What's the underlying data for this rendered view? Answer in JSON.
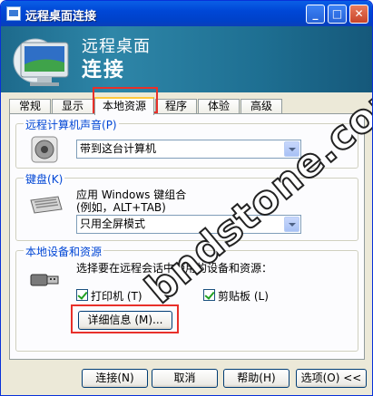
{
  "window": {
    "title": "远程桌面连接",
    "controls": {
      "minimize": "_",
      "maximize": "□",
      "close": "✕"
    }
  },
  "banner": {
    "line1": "远程桌面",
    "line2": "连接"
  },
  "tabs": [
    {
      "label": "常规",
      "active": false
    },
    {
      "label": "显示",
      "active": false
    },
    {
      "label": "本地资源",
      "active": true
    },
    {
      "label": "程序",
      "active": false
    },
    {
      "label": "体验",
      "active": false
    },
    {
      "label": "高级",
      "active": false
    }
  ],
  "sound": {
    "legend": "远程计算机声音",
    "hotkey": "(P)",
    "selected": "带到这台计算机"
  },
  "keyboard": {
    "legend": "键盘",
    "hotkey": "(K)",
    "desc1": "应用 Windows 键组合",
    "desc2": "(例如，ALT+TAB)",
    "selected": "只用全屏模式"
  },
  "devices": {
    "legend": "本地设备和资源",
    "desc": "选择要在远程会话中使用的设备和资源：",
    "printer_label": "打印机",
    "printer_hotkey": "(T)",
    "printer_checked": true,
    "clipboard_label": "剪贴板",
    "clipboard_hotkey": "(L)",
    "clipboard_checked": true,
    "details_button": "详细信息 (M)..."
  },
  "footer": {
    "connect": "连接(N)",
    "cancel": "取消",
    "help": "帮助(H)",
    "options": "选项(O) <<"
  },
  "watermark": "bndstone.com",
  "colors": {
    "titlebar": "#0047d6",
    "banner": "#1e6f92",
    "legend": "#0046d5",
    "highlight_box": "#e8302a"
  }
}
